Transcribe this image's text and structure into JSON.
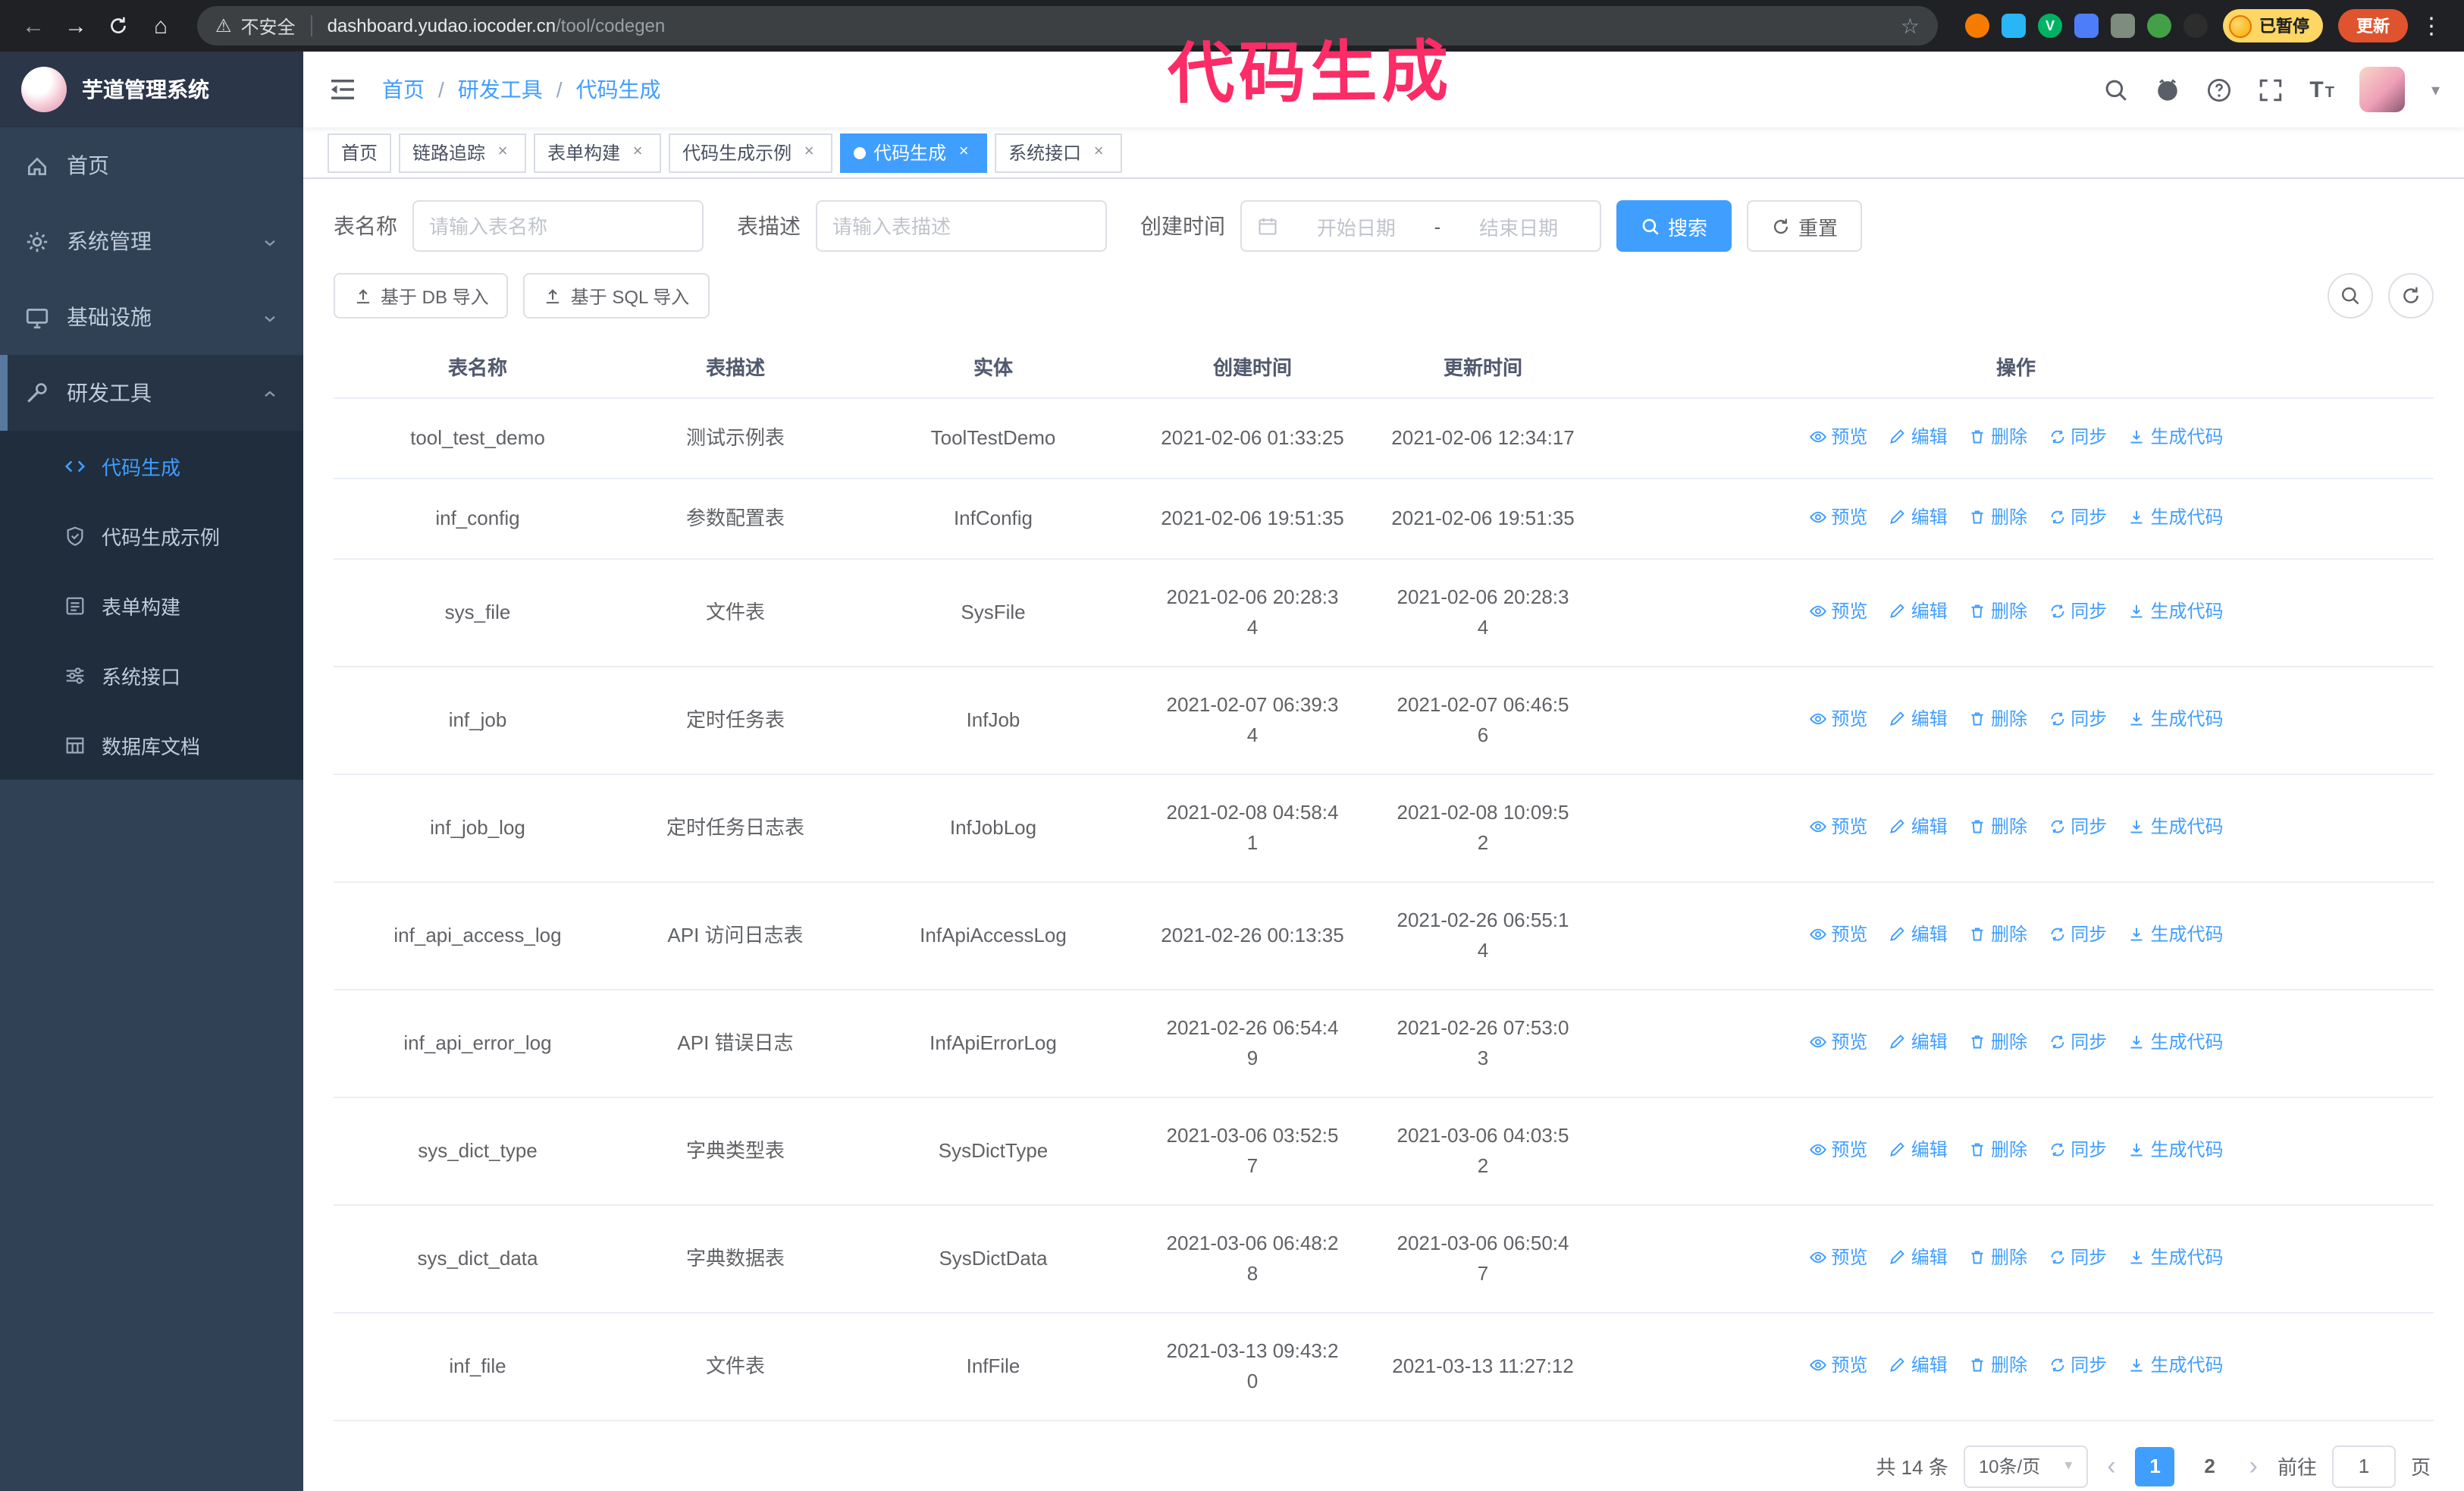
{
  "browser": {
    "security_warning": "不安全",
    "url_host": "dashboard.yudao.iocoder.cn",
    "url_path": "/tool/codegen",
    "paused_badge": "已暂停",
    "update_button": "更新"
  },
  "icons": {
    "back": "←",
    "forward": "→",
    "home": "⌂",
    "warning": "⚠",
    "star": "☆",
    "kebab": "⋮",
    "close": "×",
    "caret_down": "▾",
    "prev": "‹",
    "next": "›",
    "font_large": "T",
    "font_small": "T",
    "ext_v": "V"
  },
  "annotation": {
    "text": "代码生成",
    "color": "#fb2c66"
  },
  "theme": {
    "primary": "#409eff",
    "sidebar_bg": "#304156",
    "submenu_bg": "#1f2d3d"
  },
  "sidebar": {
    "logo_title": "芋道管理系统",
    "items": [
      {
        "label": "首页"
      },
      {
        "label": "系统管理"
      },
      {
        "label": "基础设施"
      },
      {
        "label": "研发工具"
      }
    ],
    "subitems": [
      {
        "label": "代码生成"
      },
      {
        "label": "代码生成示例"
      },
      {
        "label": "表单构建"
      },
      {
        "label": "系统接口"
      },
      {
        "label": "数据库文档"
      }
    ]
  },
  "header": {
    "breadcrumb": [
      "首页",
      "研发工具",
      "代码生成"
    ],
    "separator": "/"
  },
  "tabs": [
    {
      "label": "首页"
    },
    {
      "label": "链路追踪"
    },
    {
      "label": "表单构建"
    },
    {
      "label": "代码生成示例"
    },
    {
      "label": "代码生成"
    },
    {
      "label": "系统接口"
    }
  ],
  "filters": {
    "table_name_label": "表名称",
    "table_name_placeholder": "请输入表名称",
    "table_desc_label": "表描述",
    "table_desc_placeholder": "请输入表描述",
    "create_time_label": "创建时间",
    "start_date_placeholder": "开始日期",
    "date_separator": "-",
    "end_date_placeholder": "结束日期",
    "search_button": "搜索",
    "reset_button": "重置"
  },
  "toolbar": {
    "import_db_button": "基于 DB 导入",
    "import_sql_button": "基于 SQL 导入"
  },
  "table": {
    "columns": [
      "表名称",
      "表描述",
      "实体",
      "创建时间",
      "更新时间",
      "操作"
    ],
    "actions": [
      "预览",
      "编辑",
      "删除",
      "同步",
      "生成代码"
    ],
    "rows": [
      {
        "name": "tool_test_demo",
        "desc": "测试示例表",
        "entity": "ToolTestDemo",
        "created": "2021-02-06 01:33:25",
        "updated": "2021-02-06 12:34:17"
      },
      {
        "name": "inf_config",
        "desc": "参数配置表",
        "entity": "InfConfig",
        "created": "2021-02-06 19:51:35",
        "updated": "2021-02-06 19:51:35"
      },
      {
        "name": "sys_file",
        "desc": "文件表",
        "entity": "SysFile",
        "created": "2021-02-06 20:28:3\n4",
        "updated": "2021-02-06 20:28:3\n4"
      },
      {
        "name": "inf_job",
        "desc": "定时任务表",
        "entity": "InfJob",
        "created": "2021-02-07 06:39:3\n4",
        "updated": "2021-02-07 06:46:5\n6"
      },
      {
        "name": "inf_job_log",
        "desc": "定时任务日志表",
        "entity": "InfJobLog",
        "created": "2021-02-08 04:58:4\n1",
        "updated": "2021-02-08 10:09:5\n2"
      },
      {
        "name": "inf_api_access_log",
        "desc": "API 访问日志表",
        "entity": "InfApiAccessLog",
        "created": "2021-02-26 00:13:35",
        "updated": "2021-02-26 06:55:1\n4"
      },
      {
        "name": "inf_api_error_log",
        "desc": "API 错误日志",
        "entity": "InfApiErrorLog",
        "created": "2021-02-26 06:54:4\n9",
        "updated": "2021-02-26 07:53:0\n3"
      },
      {
        "name": "sys_dict_type",
        "desc": "字典类型表",
        "entity": "SysDictType",
        "created": "2021-03-06 03:52:5\n7",
        "updated": "2021-03-06 04:03:5\n2"
      },
      {
        "name": "sys_dict_data",
        "desc": "字典数据表",
        "entity": "SysDictData",
        "created": "2021-03-06 06:48:2\n8",
        "updated": "2021-03-06 06:50:4\n7"
      },
      {
        "name": "inf_file",
        "desc": "文件表",
        "entity": "InfFile",
        "created": "2021-03-13 09:43:2\n0",
        "updated": "2021-03-13 11:27:12"
      }
    ]
  },
  "pagination": {
    "total": "共 14 条",
    "page_size": "10条/页",
    "pages": [
      "1",
      "2"
    ],
    "goto_label": "前往",
    "goto_value": "1",
    "page_suffix": "页"
  }
}
